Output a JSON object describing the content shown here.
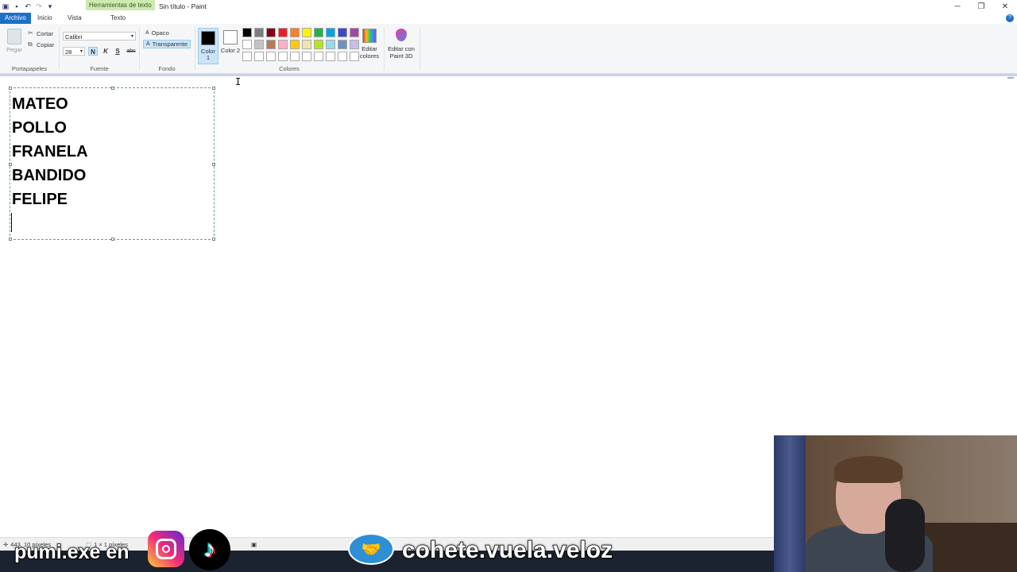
{
  "window": {
    "title": "Sin título - Paint",
    "context_tab": "Herramientas de texto"
  },
  "tabs": {
    "file": "Archivo",
    "home": "Inicio",
    "view": "Vista",
    "text": "Texto"
  },
  "ribbon": {
    "clipboard": {
      "label": "Portapapeles",
      "paste": "Pegar",
      "cut": "Cortar",
      "copy": "Copiar"
    },
    "font": {
      "label": "Fuente",
      "family": "Calibri",
      "size": "28",
      "bold": "N",
      "italic": "K",
      "underline": "S",
      "strike": "abc"
    },
    "background": {
      "label": "Fondo",
      "opaque": "Opaco",
      "transparent": "Transparente"
    },
    "colors": {
      "label": "Colores",
      "color1": "Color 1",
      "color2": "Color 2",
      "color1_value": "#000000",
      "color2_value": "#ffffff",
      "palette": [
        "#000000",
        "#7f7f7f",
        "#880015",
        "#ed1c24",
        "#ff7f27",
        "#fff200",
        "#22b14c",
        "#00a2e8",
        "#3f48cc",
        "#a349a4",
        "#ffffff",
        "#c3c3c3",
        "#b97a57",
        "#ffaec9",
        "#ffc90e",
        "#efe4b0",
        "#b5e61d",
        "#99d9ea",
        "#7092be",
        "#c8bfe7",
        "#ffffff",
        "#ffffff",
        "#ffffff",
        "#ffffff",
        "#ffffff",
        "#ffffff",
        "#ffffff",
        "#ffffff",
        "#ffffff",
        "#ffffff"
      ],
      "edit_colors": "Editar colores",
      "paint3d": "Editar con Paint 3D"
    }
  },
  "canvas": {
    "lines": [
      "MATEO",
      "POLLO",
      "FRANELA",
      "BANDIDO",
      "FELIPE"
    ]
  },
  "status": {
    "cursor_pos": "443, 10 píxeles",
    "selection_size": "1 × 1 píxeles"
  },
  "overlay": {
    "left_text": "pumi.exe en",
    "right_text": "cohete.vuela.veloz"
  }
}
